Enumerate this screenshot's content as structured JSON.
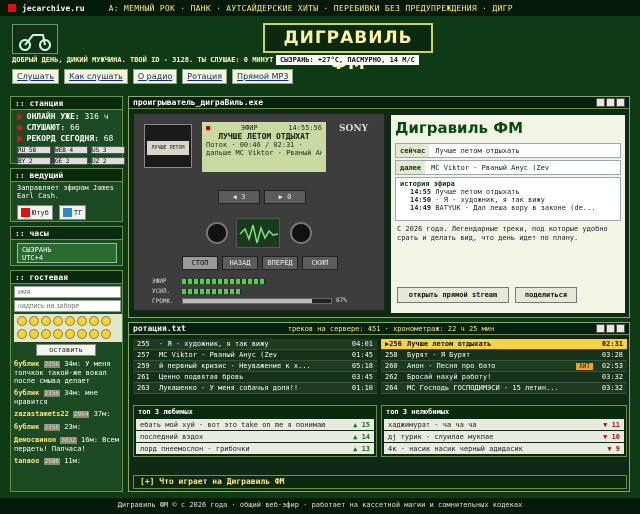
{
  "topbar": {
    "domain": "jecarchive.ru",
    "nav": "А: МЕМНЫЙ РОК · ПАНК · АУТСАЙДЕРСКИЕ ХИТЫ · ПЕРЕБИВКИ БЕЗ ПРЕДУПРЕЖДЕНИЯ · ДИГР"
  },
  "site": {
    "title": "ДИГРАВИЛЬ ФМ",
    "tagline": "ДОБРЫЙ ДЕНЬ, ДИКИЙ МУЖЧИНА. ТВОЙ ID - 3128. ТЫ СЛУШАЕ: 0 МИНУТ",
    "weather": "СЫЗРАНЬ: +27°C, ПАСМУРНО, 14 М/С"
  },
  "menu": [
    "Слушать",
    "Как слушать",
    "О радио",
    "Ротация",
    "Прямой MP3"
  ],
  "station": {
    "header": ":: станция",
    "online_label": "ОНЛАЙН УЖЕ:",
    "online": "316 ч",
    "listen_label": "СЛУШАЮТ:",
    "listen": "66",
    "record_label": "РЕКОРД СЕГОДНЯ:",
    "record": "68",
    "flags": [
      "RU 58",
      "WEB 4",
      "US 3",
      "BY 2",
      "GE 2",
      "UZ 2"
    ]
  },
  "host": {
    "header": ":: ведущий",
    "text": "Заправляет эфиром James Earl Cash.",
    "youtube": "Ютуб",
    "tg": "ТГ"
  },
  "clock": {
    "header": ":: часы",
    "city": "СЫЗРАНЬ",
    "tz": "UTC+4"
  },
  "guestbook": {
    "header": ":: гостевая",
    "name_placeholder": "имя",
    "msg_placeholder": "надпись на заборе",
    "send": "оставить",
    "posts": [
      {
        "name": "бублик",
        "badge": "2356",
        "age": "34м:",
        "text": "У меня толчкок такой-же вокал после смыва делает"
      },
      {
        "name": "бублик",
        "badge": "2356",
        "age": "34м:",
        "text": "мне нравится"
      },
      {
        "name": "zazastamets22",
        "badge": "2954",
        "age": "37м:",
        "text": ""
      },
      {
        "name": "бублик",
        "badge": "2356",
        "age": "23м:",
        "text": ""
      },
      {
        "name": "Демосвинон",
        "badge": "3032",
        "age": "16м:",
        "text": "Всем пердеть! Палчаса!"
      },
      {
        "name": "tanaoo",
        "badge": "2586",
        "age": "11м:",
        "text": ""
      }
    ]
  },
  "player": {
    "header": "проигрыватель_диграВиль.exe",
    "ether": "ЭФИР",
    "time": "14:55:56",
    "brand": "SONY",
    "now": "ЛУЧШЕ ЛЕТОМ ОТДЫХАТ",
    "stream": "Поток · 00:46 / 02:31 ·",
    "next": "дальше МС Viktor - Рваный Анус (Zev",
    "cassette_label": "ЛУЧШЕ ЛЕТОМ",
    "rew": "◀ 3",
    "ff": "▶ 0",
    "stop": "СТОП",
    "back": "НАЗАД",
    "fwd": "ВПЕРЁД",
    "skip": "СКИП",
    "ether_bar": "ЭФИР",
    "gain": "УСИЛ.",
    "vol": "ГРОМК.",
    "vol_val": "87%",
    "vol_level": 0.87
  },
  "info": {
    "title": "Дигравиль ФМ",
    "now_k": "сейчас",
    "now_v": "Лучше летом отдыхать",
    "next_k": "далее",
    "next_v": "МС Viktor - Рваный Анус (Zev",
    "hist_title": "история эфира",
    "history": [
      {
        "t": "14:55",
        "s": "Лучше летом отдыхать"
      },
      {
        "t": "14:50",
        "s": "- Я - художник, я так вижу"
      },
      {
        "t": "14:49",
        "s": "BATYUK - Дал леша вору в законе (de..."
      }
    ],
    "about": "С 2026 года. Легендарные треки, под которые удобно срать и делать вид, что день идет по плану.",
    "about_bold": "С 2026 года.",
    "open_btn": "открыть прямой stream",
    "share_btn": "поделиться"
  },
  "rotation": {
    "header": "ротация.txt",
    "stats": "треков на сервере: 451 · хронометраж: 22 ч 25 мин",
    "left": [
      {
        "n": "255",
        "t": "- Я - художник, я так вижу",
        "d": "04:01"
      },
      {
        "n": "257",
        "t": "МС Viktor - Рваный Анус (Zev",
        "d": "01:45"
      },
      {
        "n": "259",
        "t": "й первный кризис - Неуважение к х...",
        "d": "05:18"
      },
      {
        "n": "261",
        "t": "Ценно подвятая бровь",
        "d": "03:45"
      },
      {
        "n": "263",
        "t": "Лукашенко - У меня собачья доля!!",
        "d": "01:10"
      }
    ],
    "right": [
      {
        "n": "256",
        "t": "Лучше летом отдыхать",
        "d": "02:31",
        "cur": true
      },
      {
        "n": "258",
        "t": "Бурят - Я Бурят",
        "d": "03:28"
      },
      {
        "n": "260",
        "t": "Анон - Песня про бато",
        "d": "02:53",
        "hit": "ХИТ"
      },
      {
        "n": "262",
        "t": "Бросай нахуй работу!",
        "d": "03:32"
      },
      {
        "n": "264",
        "t": "МС Господь ГОСПОДИМЭСИ - 15 летин...",
        "d": "03:32"
      }
    ],
    "top_liked": {
      "header": "топ 3 любимых",
      "items": [
        {
          "t": "ебать мой хуй - вот это take on me я понимаю",
          "v": "▲ 15"
        },
        {
          "t": "последний вздох",
          "v": "▲ 14"
        },
        {
          "t": "лорд пнеемослон - грибочки",
          "v": "▲ 13"
        }
      ]
    },
    "top_hated": {
      "header": "топ 3 нелюбимых",
      "items": [
        {
          "t": "хаджимурат - ча ча ча",
          "v": "▼ 11"
        },
        {
          "t": "дj турик - слуилае мукпае",
          "v": "▼ 10"
        },
        {
          "t": "4к - насик насик черный адидасик",
          "v": "▼ 9"
        }
      ]
    },
    "whats": "[+] Что играет на Дигравиль ФМ"
  },
  "footer": "Дигравиль ФМ © с 2026 года · общий веб-эфир · работает на кассетной магии и сомнительных кодеках"
}
